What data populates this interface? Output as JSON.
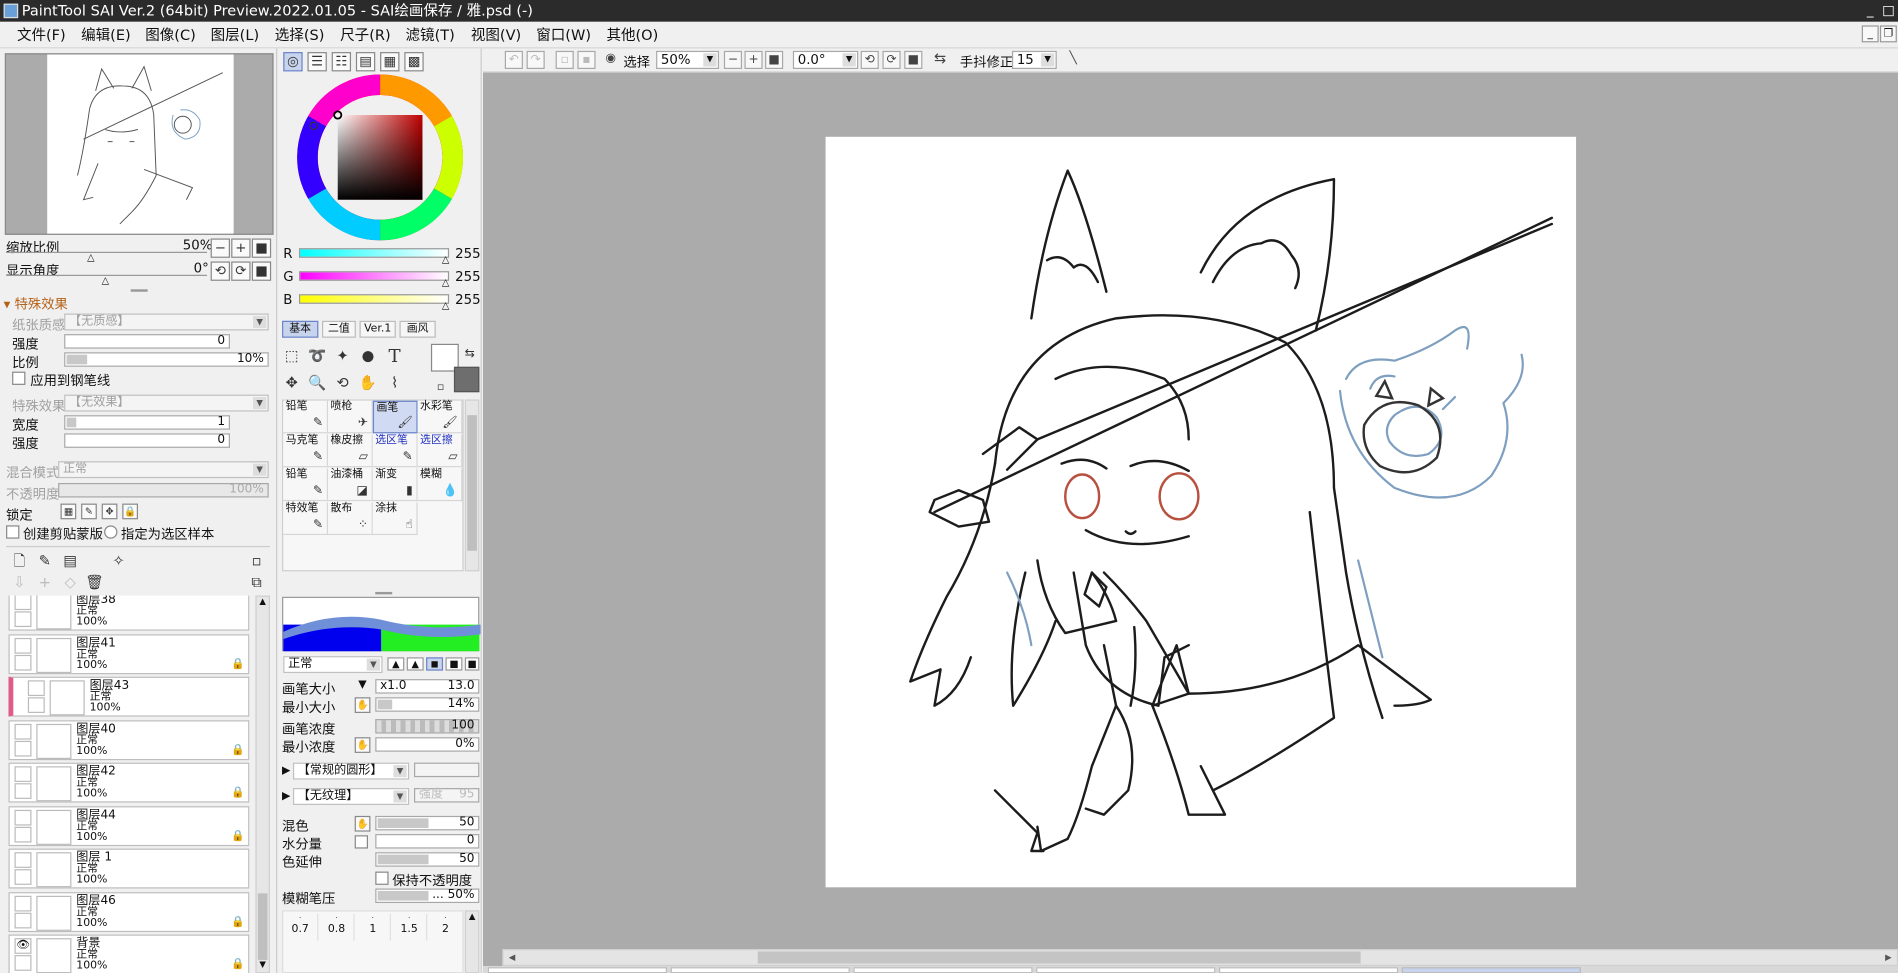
{
  "window": {
    "title": "PaintTool SAI Ver.2 (64bit) Preview.2022.01.05 - SAI绘画保存 / 雅.psd (-)",
    "controls": [
      "_",
      "□"
    ]
  },
  "menu": [
    {
      "label": "文件(F)"
    },
    {
      "label": "编辑(E)"
    },
    {
      "label": "图像(C)"
    },
    {
      "label": "图层(L)"
    },
    {
      "label": "选择(S)"
    },
    {
      "label": "尺子(R)"
    },
    {
      "label": "滤镜(T)"
    },
    {
      "label": "视图(V)"
    },
    {
      "label": "窗口(W)"
    },
    {
      "label": "其他(O)"
    }
  ],
  "navigator": {
    "zoom_label": "缩放比例",
    "zoom_value": "50%",
    "angle_label": "显示角度",
    "angle_value": "0°"
  },
  "effects": {
    "header": "特殊效果",
    "paper_texture_label": "纸张质感",
    "paper_texture_value": "【无质感】",
    "strength_label": "强度",
    "strength_value": "0",
    "ratio_label": "比例",
    "ratio_value": "10%",
    "ratio_fraction": 0.1,
    "apply_pen_label": "应用到钢笔线",
    "effect_label": "特殊效果",
    "effect_value": "【无效果】",
    "width_label": "宽度",
    "width_value": "1",
    "strength2_label": "强度",
    "strength2_value": "0",
    "blend_mode_label": "混合模式",
    "blend_mode_value": "正常",
    "opacity_label": "不透明度",
    "opacity_value": "100%",
    "lock_label": "锁定",
    "clip_label": "创建剪贴蒙版",
    "selection_source_label": "指定为选区样本"
  },
  "layers": [
    {
      "name": "图层38",
      "mode": "正常",
      "opacity": "100%",
      "visible": false,
      "locked": false,
      "selected": false
    },
    {
      "name": "图层41",
      "mode": "正常",
      "opacity": "100%",
      "visible": false,
      "locked": true,
      "selected": false
    },
    {
      "name": "图层43",
      "mode": "正常",
      "opacity": "100%",
      "visible": false,
      "locked": false,
      "selected": true
    },
    {
      "name": "图层40",
      "mode": "正常",
      "opacity": "100%",
      "visible": false,
      "locked": true,
      "selected": false
    },
    {
      "name": "图层42",
      "mode": "正常",
      "opacity": "100%",
      "visible": false,
      "locked": true,
      "selected": false
    },
    {
      "name": "图层44",
      "mode": "正常",
      "opacity": "100%",
      "visible": false,
      "locked": true,
      "selected": false
    },
    {
      "name": "图层 1",
      "mode": "正常",
      "opacity": "100%",
      "visible": false,
      "locked": false,
      "selected": false
    },
    {
      "name": "图层46",
      "mode": "正常",
      "opacity": "100%",
      "visible": false,
      "locked": true,
      "selected": false
    },
    {
      "name": "背景",
      "mode": "正常",
      "opacity": "100%",
      "visible": true,
      "locked": true,
      "selected": false
    }
  ],
  "color": {
    "R": "255",
    "G": "255",
    "B": "255",
    "R_label": "R",
    "G_label": "G",
    "B_label": "B",
    "current": "#ffffff",
    "secondary": "#6e6e6e"
  },
  "tool_tabs": [
    {
      "label": "基本",
      "selected": true
    },
    {
      "label": "二值",
      "selected": false
    },
    {
      "label": "Ver.1",
      "selected": false
    },
    {
      "label": "画风",
      "selected": false
    }
  ],
  "brushes": [
    {
      "name": "铅笔",
      "icon": "✎",
      "selected": false,
      "blue": false
    },
    {
      "name": "喷枪",
      "icon": "✈",
      "selected": false,
      "blue": false
    },
    {
      "name": "画笔",
      "icon": "🖌",
      "selected": true,
      "blue": false
    },
    {
      "name": "水彩笔",
      "icon": "🖌",
      "selected": false,
      "blue": false
    },
    {
      "name": "马克笔",
      "icon": "✎",
      "selected": false,
      "blue": false
    },
    {
      "name": "橡皮擦",
      "icon": "▱",
      "selected": false,
      "blue": false
    },
    {
      "name": "选区笔",
      "icon": "✎",
      "selected": false,
      "blue": true
    },
    {
      "name": "选区擦",
      "icon": "▱",
      "selected": false,
      "blue": true
    },
    {
      "name": "铅笔",
      "icon": "✎",
      "selected": false,
      "blue": false
    },
    {
      "name": "油漆桶",
      "icon": "◪",
      "selected": false,
      "blue": false
    },
    {
      "name": "渐变",
      "icon": "▮",
      "selected": false,
      "blue": false
    },
    {
      "name": "模糊",
      "icon": "💧",
      "selected": false,
      "blue": false
    },
    {
      "name": "特效笔",
      "icon": "✎",
      "selected": false,
      "blue": false
    },
    {
      "name": "散布",
      "icon": "⁘",
      "selected": false,
      "blue": false
    },
    {
      "name": "涂抹",
      "icon": "☝",
      "selected": false,
      "blue": false
    }
  ],
  "brush_settings": {
    "mode_value": "正常",
    "size_label": "画笔大小",
    "size_mult": "x1.0",
    "size_value": "13.0",
    "min_size_label": "最小大小",
    "min_size_value": "14%",
    "min_size_fraction": 0.14,
    "density_label": "画笔浓度",
    "density_value": "100",
    "density_fraction": 1.0,
    "min_density_label": "最小浓度",
    "min_density_value": "0%",
    "shape_value": "【常规的圆形】",
    "texture_value": "【无纹理】",
    "texture_strength_label": "强度",
    "texture_strength_value": "95",
    "blend_label": "混色",
    "blend_value": "50",
    "blend_fraction": 0.5,
    "water_label": "水分量",
    "water_value": "0",
    "stretch_label": "色延伸",
    "stretch_value": "50",
    "stretch_fraction": 0.5,
    "keep_opacity_label": "保持不透明度",
    "pressure_label": "模糊笔压",
    "pressure_value": "... 50%"
  },
  "size_presets": [
    "0.7",
    "0.8",
    "1",
    "1.5",
    "2"
  ],
  "canvas_toolbar": {
    "select_label": "选择",
    "zoom_value": "50%",
    "angle_value": "0.0°",
    "stabilizer_label": "手抖修正",
    "stabilizer_value": "15"
  }
}
